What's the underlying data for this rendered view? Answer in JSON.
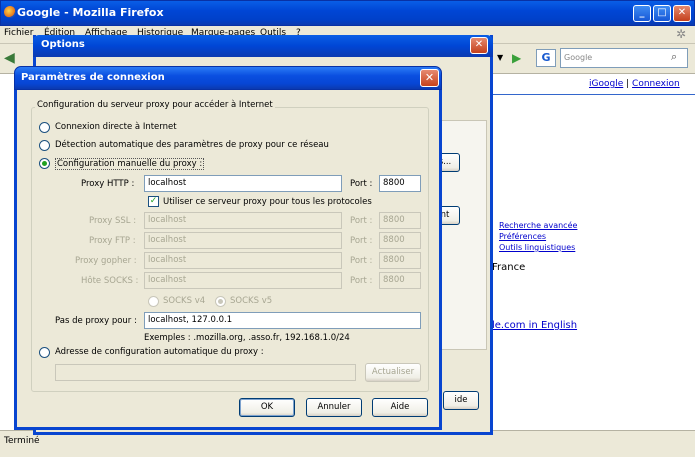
{
  "firefox": {
    "title": "Google - Mozilla Firefox",
    "menu": [
      "Fichier",
      "Édition",
      "Affichage",
      "Historique",
      "Marque-pages",
      "Outils",
      "?"
    ],
    "search_placeholder": "Google",
    "status": "Terminé",
    "page": {
      "top_links": [
        "iGoogle",
        "|",
        "Connexion"
      ],
      "side_links": [
        "Recherche avancée",
        "Préférences",
        "Outils linguistiques"
      ],
      "france": "France",
      "english": "le.com in English"
    }
  },
  "options_dialog": {
    "title": "Options",
    "partial_buttons": [
      "s...",
      "nt",
      "ide"
    ]
  },
  "connexion_dialog": {
    "title": "Paramètres de connexion",
    "group_label": "Configuration du serveur proxy pour accéder à Internet",
    "radio_direct": "Connexion directe à Internet",
    "radio_auto_detect": "Détection automatique des paramètres de proxy pour ce réseau",
    "radio_manual": "Configuration manuelle du proxy :",
    "http_label": "Proxy HTTP :",
    "http_value": "localhost",
    "http_port_label": "Port :",
    "http_port_value": "8800",
    "use_same_label": "Utiliser ce serveur proxy pour tous les protocoles",
    "ssl_label": "Proxy SSL :",
    "ssl_value": "localhost",
    "ssl_port_label": "Port :",
    "ssl_port_value": "8800",
    "ftp_label": "Proxy FTP :",
    "ftp_value": "localhost",
    "ftp_port_label": "Port :",
    "ftp_port_value": "8800",
    "gopher_label": "Proxy gopher :",
    "gopher_value": "localhost",
    "gopher_port_label": "Port :",
    "gopher_port_value": "8800",
    "socks_label": "Hôte SOCKS :",
    "socks_value": "localhost",
    "socks_port_label": "Port :",
    "socks_port_value": "8800",
    "socks_v4": "SOCKS v4",
    "socks_v5": "SOCKS v5",
    "no_proxy_label": "Pas de proxy pour :",
    "no_proxy_value": "localhost, 127.0.0.1",
    "example": "Exemples : .mozilla.org, .asso.fr, 192.168.1.0/24",
    "radio_auto_url": "Adresse de configuration automatique du proxy :",
    "auto_url_value": "",
    "reload_button": "Actualiser",
    "ok_button": "OK",
    "cancel_button": "Annuler",
    "help_button": "Aide"
  }
}
